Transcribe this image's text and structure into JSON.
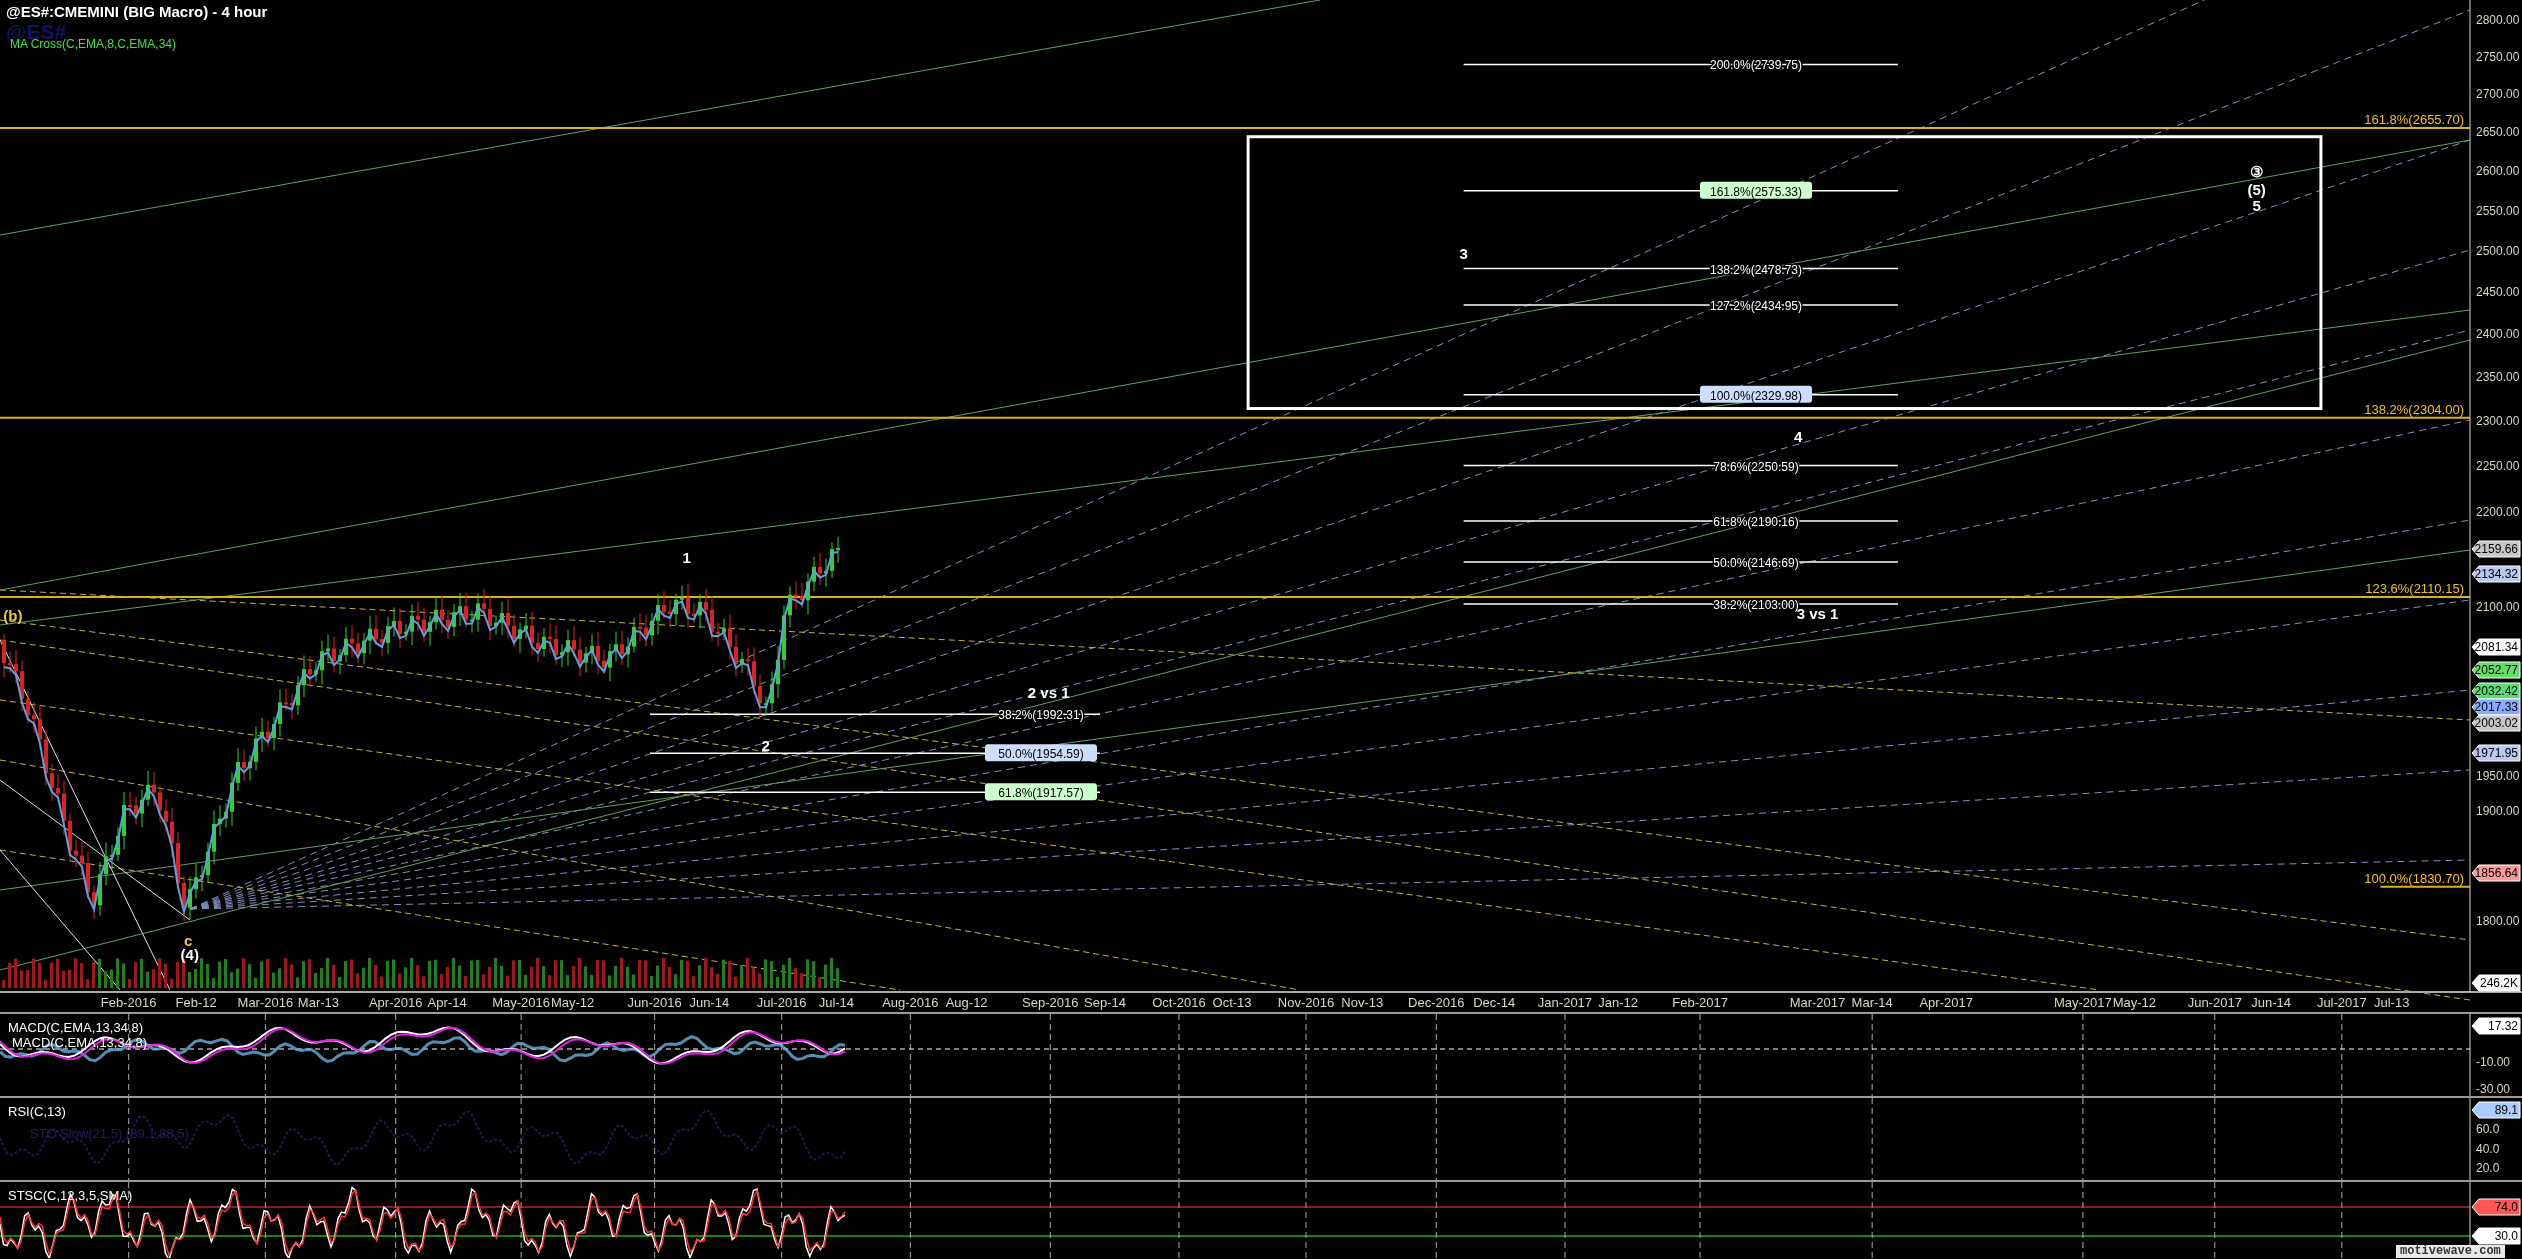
{
  "title": "@ES#:CMEMINI (BIG Macro) - 4 hour",
  "symbol": "@ES#",
  "study_label": "MA Cross(C,EMA,8,C,EMA,34)",
  "price_axis": [
    "2800.00",
    "2750.00",
    "2700.00",
    "2650.00",
    "2600.00",
    "2550.00",
    "2500.00",
    "2450.00",
    "2400.00",
    "2350.00",
    "2300.00",
    "2250.00",
    "2200.00",
    "2100.00",
    "1950.00",
    "1900.00",
    "1800.00"
  ],
  "price_tags": [
    {
      "text": "2159.66",
      "color": "#c8c8c8"
    },
    {
      "text": "2134.32",
      "color": "#b8c8f0"
    },
    {
      "text": "2081.34",
      "color": "#ffffff"
    },
    {
      "text": "2052.77",
      "color": "#66dd66"
    },
    {
      "text": "2032.42",
      "color": "#55dd77"
    },
    {
      "text": "2017.33",
      "color": "#88aaff"
    },
    {
      "text": "2003.02",
      "color": "#c8c8c8"
    },
    {
      "text": "1971.95",
      "color": "#b8c8f0"
    },
    {
      "text": "1856.64",
      "color": "#ff9999"
    },
    {
      "text": "246.2K",
      "color": "#ffffff"
    }
  ],
  "yellow_levels": [
    {
      "label": "161.8%(2655.70)"
    },
    {
      "label": "138.2%(2304.00)"
    },
    {
      "label": "123.6%(2110.15)"
    },
    {
      "label": "100.0%(1830.70)"
    }
  ],
  "projection_levels": [
    {
      "label": "200.0%(2739.75)",
      "boxed": false
    },
    {
      "label": "161.8%(2575.33)",
      "boxed": true,
      "color": "#ccffcc"
    },
    {
      "label": "138.2%(2478.73)",
      "boxed": false
    },
    {
      "label": "127.2%(2434.95)",
      "boxed": false
    },
    {
      "label": "100.0%(2329.98)",
      "boxed": true,
      "color": "#ccddff"
    },
    {
      "label": "78.6%(2250.59)",
      "boxed": false
    },
    {
      "label": "61.8%(2190.16)",
      "boxed": false
    },
    {
      "label": "50.0%(2146.69)",
      "boxed": false
    },
    {
      "label": "38.2%(2103.00)",
      "boxed": false
    }
  ],
  "retracement_levels": [
    {
      "label": "38.2%(1992.31)",
      "boxed": false
    },
    {
      "label": "50.0%(1954.59)",
      "boxed": true,
      "color": "#ccddff"
    },
    {
      "label": "61.8%(1917.57)",
      "boxed": true,
      "color": "#ccffcc"
    }
  ],
  "wave_labels": [
    {
      "text": "(b)",
      "color": "#e8c840"
    },
    {
      "text": "c",
      "color": "#e8c840"
    },
    {
      "text": "(4)",
      "color": "#ffffff"
    },
    {
      "text": "1",
      "color": "#ffffff"
    },
    {
      "text": "2",
      "color": "#ffffff"
    },
    {
      "text": "2 vs 1",
      "color": "#ffffff"
    },
    {
      "text": "3",
      "color": "#ffffff"
    },
    {
      "text": "4",
      "color": "#ffffff"
    },
    {
      "text": "3 vs 1",
      "color": "#ffffff"
    },
    {
      "text": "③",
      "color": "#ffffff"
    },
    {
      "text": "(5)",
      "color": "#ffffff"
    },
    {
      "text": "5",
      "color": "#ffffff"
    }
  ],
  "date_axis": [
    "Feb-2016",
    "Feb-12",
    "Mar-2016",
    "Mar-13",
    "Apr-2016",
    "Apr-14",
    "May-2016",
    "May-12",
    "Jun-2016",
    "Jun-14",
    "Jul-2016",
    "Jul-14",
    "Aug-2016",
    "Aug-12",
    "Sep-2016",
    "Sep-14",
    "Oct-2016",
    "Oct-13",
    "Nov-2016",
    "Nov-13",
    "Dec-2016",
    "Dec-14",
    "Jan-2017",
    "Jan-12",
    "Feb-2017",
    "Mar-2017",
    "Mar-14",
    "Apr-2017",
    "May-2017",
    "May-12",
    "Jun-2017",
    "Jun-14",
    "Jul-2017",
    "Jul-13"
  ],
  "panels": [
    {
      "kind": "macd",
      "title": "MACD(C,EMA,13,34,8)",
      "subtitle": "MACD(C,EMA,13,34,8)",
      "axis": [
        "-10.00",
        "-30.00"
      ],
      "tags": [
        {
          "text": "17.32",
          "color": "#ffffff"
        }
      ]
    },
    {
      "kind": "rsi",
      "title": "RSI(C,13)",
      "subtitle": "STO Slow(21,5) (89.1,88.5)",
      "axis": [
        "60.0",
        "40.0",
        "20.0"
      ],
      "tags": [
        {
          "text": "89.1",
          "color": "#aaccff"
        }
      ]
    },
    {
      "kind": "stsc",
      "title": "STSC(C,12,3,5,SMA)",
      "tags": [
        {
          "text": "74.0",
          "color": "#ff5555"
        },
        {
          "text": "30.0",
          "color": "#ffffff"
        }
      ]
    }
  ],
  "brand": "motivewave.com"
}
